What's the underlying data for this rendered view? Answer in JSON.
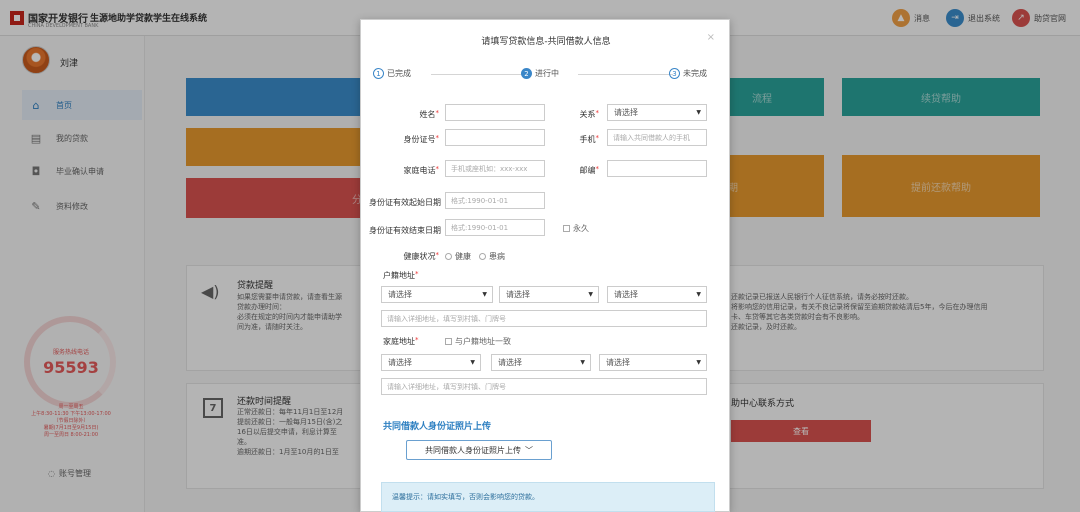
{
  "header": {
    "bank_name": "国家开发银行",
    "bank_sub": "CHINA DEVELOPMENT BANK",
    "system_name": "生源地助学贷款学生在线系统",
    "messages_label": "消息",
    "logout_label": "退出系统",
    "help_label": "助贷官网"
  },
  "sidebar": {
    "username": "刘津",
    "items": [
      {
        "label": "首页",
        "icon": "home-icon"
      },
      {
        "label": "我的贷款",
        "icon": "document-icon"
      },
      {
        "label": "毕业确认申请",
        "icon": "inbox-icon"
      },
      {
        "label": "资料修改",
        "icon": "edit-icon"
      }
    ],
    "hotline_label": "服务热线电话",
    "hotline_number": "95593",
    "service_line1": "周一至周五",
    "service_line2": "上午8:30-11:30 下午13:00-17:00",
    "service_line3": "（节假日除外）",
    "service_line4": "暑期(7月1日至9月15日)",
    "service_line5": "周一至周日 8:00-21:00",
    "account_label": "账号管理"
  },
  "background": {
    "tiles": {
      "flow": "流程",
      "renew_help": "续贷帮助",
      "split": "分",
      "repay_top": "期",
      "prepay_help": "提前还款帮助"
    },
    "reminder_title": "贷款提醒",
    "reminder_lines": [
      "如果您需要申请贷款，请查看生源",
      "贷款办理时间：",
      "必须在规定的时间内才能申请助学",
      "间为准，请随时关注。"
    ],
    "reminder_right_lines": [
      "还款记录已报送人民银行个人征信系统，请务必按时还款。",
      "将影响您的信用记录，有关不良记录将保留至逾期贷款结清后5年，今后在办理信用",
      "卡、车贷等其它各类贷款时会有不良影响。",
      "还款记录，及时还款。"
    ],
    "repay_title": "还款时间提醒",
    "repay_lines": [
      "正常还款日：每年11月1日至12月",
      "提前还款日：一般每月15日(含)之",
      "16日以后提交申请，利息计算至",
      "准。",
      "逾期还款日：1月至10月的1日至"
    ],
    "contact_title": "助中心联系方式",
    "contact_button": "查看"
  },
  "modal": {
    "title": "请填写贷款信息-共同借款人信息",
    "close": "×",
    "steps": [
      {
        "num": "1",
        "label": "已完成"
      },
      {
        "num": "2",
        "label": "进行中"
      },
      {
        "num": "3",
        "label": "未完成"
      }
    ],
    "fields": {
      "name_label": "姓名",
      "relation_label": "关系",
      "relation_value": "请选择",
      "id_label": "身份证号",
      "phone_label": "手机",
      "phone_placeholder": "请输入共同借款人的手机",
      "home_phone_label": "家庭电话",
      "home_phone_placeholder": "手机或座机如：xxx-xxx",
      "zip_label": "邮编",
      "id_start_label": "身份证有效起始日期",
      "id_start_placeholder": "格式:1990-01-01",
      "id_end_label": "身份证有效结束日期",
      "id_end_placeholder": "格式:1990-01-01",
      "permanent_label": "永久",
      "health_label": "健康状况",
      "health_ok": "健康",
      "health_sick": "患病",
      "hukou_label": "户籍地址",
      "select_placeholder": "请选择",
      "address_placeholder": "请输入详细地址，填写到村镇、门牌号",
      "home_addr_label": "家庭地址",
      "same_as_hukou": "与户籍地址一致"
    },
    "upload_section_title": "共同借款人身份证照片上传",
    "upload_button": "共同借款人身份证照片上传",
    "tip": "温馨提示：请如实填写，否则会影响您的贷款。"
  },
  "colors": {
    "tile_blue": "#3b8ccb",
    "tile_teal": "#2aa39a",
    "tile_orange": "#e7992e",
    "tile_orange2": "#f0a046",
    "tile_red": "#d9534f",
    "accent": "#2d7fc1"
  }
}
